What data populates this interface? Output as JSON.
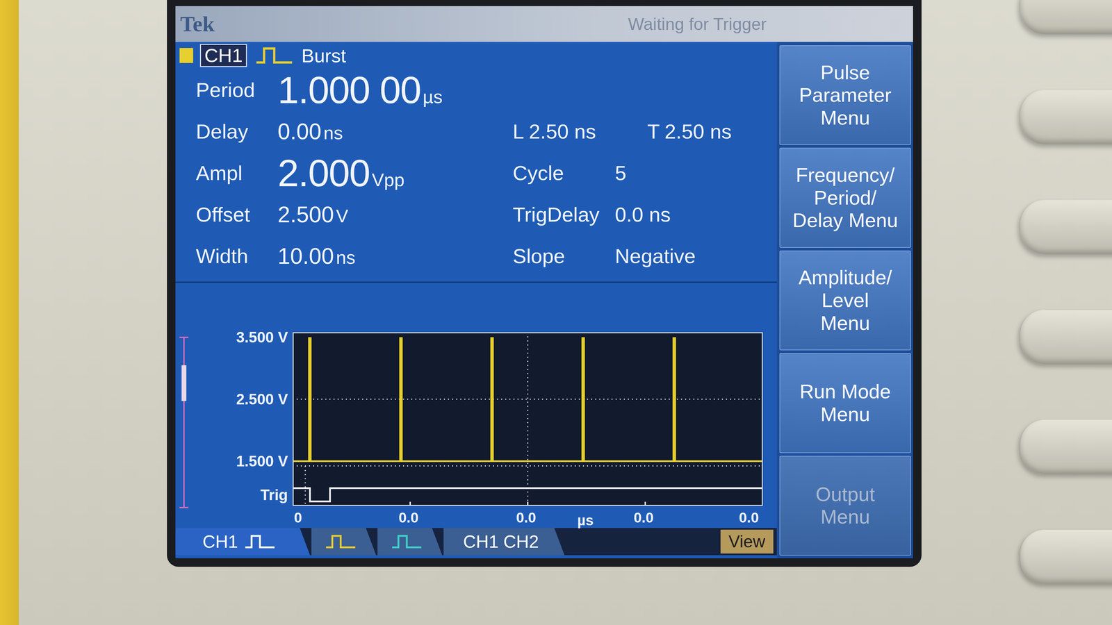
{
  "header": {
    "brand": "Tek",
    "status": "Waiting for Trigger",
    "channel": "CH1",
    "channel_color": "#e6cf2e",
    "mode": "Burst"
  },
  "params": [
    {
      "label": "Period",
      "value": "1.000 00",
      "unit": "µs",
      "kind": "large"
    },
    {
      "label": "Delay",
      "value": "0.00",
      "unit": "ns",
      "kind": "normal"
    },
    {
      "label": "Ampl",
      "value": "2.000",
      "unit": "Vpp",
      "kind": "large"
    },
    {
      "label": "Offset",
      "value": "2.500",
      "unit": "V",
      "kind": "normal"
    },
    {
      "label": "Width",
      "value": "10.00",
      "unit": "ns",
      "kind": "normal"
    }
  ],
  "settings": [
    {
      "kind": "pair",
      "items": [
        {
          "label": "L",
          "value": "2.50 ns"
        },
        {
          "label": "T",
          "value": "2.50 ns"
        }
      ]
    },
    {
      "kind": "field",
      "label": "Cycle",
      "value": "5"
    },
    {
      "kind": "field",
      "label": "TrigDelay",
      "value": "0.0 ns"
    },
    {
      "kind": "field",
      "label": "Slope",
      "value": "Negative"
    }
  ],
  "menu": [
    {
      "lines": [
        "Pulse",
        "Parameter",
        "Menu"
      ],
      "disabled": false
    },
    {
      "lines": [
        "Frequency/",
        "Period/",
        "Delay Menu"
      ],
      "disabled": false
    },
    {
      "lines": [
        "Amplitude/",
        "Level",
        "Menu"
      ],
      "disabled": false
    },
    {
      "lines": [
        "Run Mode",
        "Menu"
      ],
      "disabled": false
    },
    {
      "lines": [
        "Output",
        "Menu"
      ],
      "disabled": true
    }
  ],
  "chart": {
    "y_ticks": [
      "3.500 V",
      "2.500 V",
      "1.500 V"
    ],
    "trigger_label": "Trig",
    "x_ticks": [
      "0",
      "0.0",
      "0.0",
      "0.0",
      "0.0"
    ],
    "x_unit": "µs",
    "series": [
      {
        "color": "#e6cf2e",
        "low": 1.5,
        "high": 3.5,
        "pulse_width": 0.01,
        "pulse_starts": [
          0.17,
          1.17,
          2.17,
          3.17,
          4.17
        ]
      }
    ],
    "trigger_trace": [
      [
        0,
        1
      ],
      [
        0.19,
        1
      ],
      [
        0.19,
        0
      ],
      [
        0.41,
        0
      ],
      [
        0.41,
        1
      ],
      [
        5.16,
        1
      ]
    ]
  },
  "bottom_tabs": [
    {
      "labels": [
        "CH1"
      ],
      "kind": "label-wave",
      "color": "#ffffff",
      "selected": true
    },
    {
      "labels": [],
      "kind": "wave",
      "color": "#e6cf2e",
      "selected": false
    },
    {
      "labels": [],
      "kind": "wave",
      "color": "#3fd1c6",
      "selected": false
    },
    {
      "labels": [
        "CH1",
        "CH2"
      ],
      "kind": "labels",
      "color": "#ffffff",
      "selected": false
    }
  ],
  "view_button": {
    "label": "View"
  }
}
